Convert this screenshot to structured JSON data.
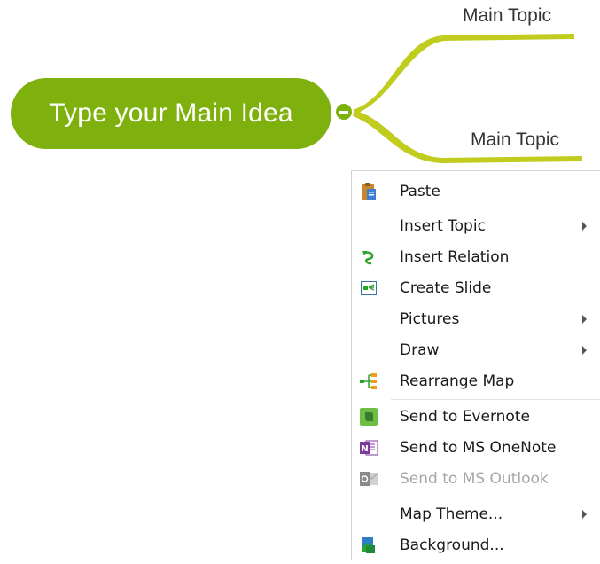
{
  "map": {
    "main_idea": "Type your Main Idea",
    "topics": [
      "Main Topic",
      "Main Topic"
    ],
    "branch_color": "#c1cd1e",
    "main_idea_color": "#7fb10e"
  },
  "context_menu": {
    "items": [
      {
        "label": "Paste",
        "icon": "paste-icon",
        "submenu": false,
        "disabled": false
      },
      {
        "label": "Insert Topic",
        "icon": "",
        "submenu": true,
        "disabled": false
      },
      {
        "label": "Insert Relation",
        "icon": "relation-icon",
        "submenu": false,
        "disabled": false
      },
      {
        "label": "Create Slide",
        "icon": "slide-icon",
        "submenu": false,
        "disabled": false
      },
      {
        "label": "Pictures",
        "icon": "",
        "submenu": true,
        "disabled": false
      },
      {
        "label": "Draw",
        "icon": "",
        "submenu": true,
        "disabled": false
      },
      {
        "label": "Rearrange Map",
        "icon": "rearrange-map-icon",
        "submenu": false,
        "disabled": false
      },
      {
        "label": "Send to Evernote",
        "icon": "evernote-icon",
        "submenu": false,
        "disabled": false
      },
      {
        "label": "Send to MS OneNote",
        "icon": "onenote-icon",
        "submenu": false,
        "disabled": false
      },
      {
        "label": "Send to MS Outlook",
        "icon": "outlook-icon",
        "submenu": false,
        "disabled": true
      },
      {
        "label": "Map Theme...",
        "icon": "",
        "submenu": true,
        "disabled": false
      },
      {
        "label": "Background...",
        "icon": "background-icon",
        "submenu": false,
        "disabled": false
      }
    ]
  }
}
